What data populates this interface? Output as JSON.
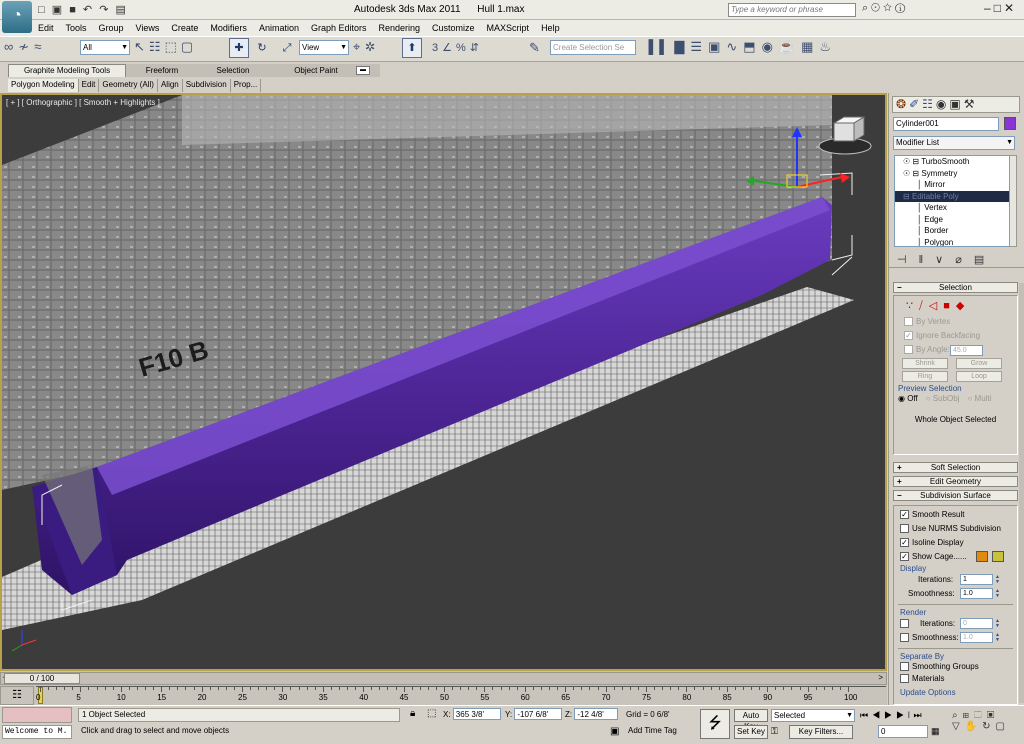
{
  "app": {
    "title": "Autodesk 3ds Max  2011",
    "file": "Hull 1.max",
    "search_placeholder": "Type a keyword or phrase"
  },
  "menu": [
    "Edit",
    "Tools",
    "Group",
    "Views",
    "Create",
    "Modifiers",
    "Animation",
    "Graph Editors",
    "Rendering",
    "Customize",
    "MAXScript",
    "Help"
  ],
  "toolbar": {
    "filter_value": "All",
    "ref_coord_value": "View",
    "named_selection_placeholder": "Create Selection Se",
    "snap_value": "3"
  },
  "ribbon": {
    "tabs": [
      "Graphite Modeling Tools",
      "Freeform",
      "Selection",
      "Object Paint"
    ],
    "subtabs": [
      "Polygon Modeling",
      "Edit",
      "Geometry (All)",
      "Align",
      "Subdivision",
      "Prop..."
    ]
  },
  "viewport": {
    "label": "[ + ] [ Orthographic ] [ Smooth + Highlights ]",
    "hull_text": "F10 B",
    "colors": {
      "hull": "#5b2fa3",
      "bg": "#3c3c3c"
    }
  },
  "panel": {
    "object_name": "Cylinder001",
    "object_color": "#8a33d6",
    "modifier_list_label": "Modifier List",
    "stack": [
      {
        "label": "TurboSmooth",
        "level": 0
      },
      {
        "label": "Symmetry",
        "level": 0
      },
      {
        "label": "Mirror",
        "level": 1
      },
      {
        "label": "Editable Poly",
        "level": 0,
        "selected": true
      },
      {
        "label": "Vertex",
        "level": 1
      },
      {
        "label": "Edge",
        "level": 1
      },
      {
        "label": "Border",
        "level": 1
      },
      {
        "label": "Polygon",
        "level": 1
      }
    ],
    "selection": {
      "title": "Selection",
      "by_vertex": "By Vertex",
      "ignore_backfacing": "Ignore Backfacing",
      "by_angle": "By Angle:",
      "angle_value": "45.0",
      "shrink": "Shrink",
      "grow": "Grow",
      "ring": "Ring",
      "loop": "Loop",
      "preview_title": "Preview Selection",
      "preview_options": [
        "Off",
        "SubObj",
        "Multi"
      ],
      "status": "Whole Object Selected"
    },
    "soft_selection": "Soft Selection",
    "edit_geometry": "Edit Geometry",
    "subdivision_surface": {
      "title": "Subdivision Surface",
      "smooth_result": "Smooth Result",
      "use_nurms": "Use NURMS Subdivision",
      "isoline": "Isoline Display",
      "show_cage": "Show Cage......",
      "cage_colors": [
        "#e08a10",
        "#c8c23a"
      ],
      "display_title": "Display",
      "iterations_label": "Iterations:",
      "iterations_value": "1",
      "smoothness_label": "Smoothness:",
      "smoothness_value": "1.0",
      "render_title": "Render",
      "render_iterations_value": "0",
      "render_smoothness_value": "1.0",
      "separate_title": "Separate By",
      "smoothing_groups": "Smoothing Groups",
      "materials": "Materials",
      "update_options": "Update Options"
    }
  },
  "timeline": {
    "frame_counter": "0 / 100",
    "ticks": [
      "0",
      "5",
      "10",
      "15",
      "20",
      "25",
      "30",
      "35",
      "40",
      "45",
      "50",
      "55",
      "60",
      "65",
      "70",
      "75",
      "80",
      "85",
      "90",
      "95",
      "100"
    ]
  },
  "status": {
    "welcome": "Welcome to M.",
    "selected": "1 Object Selected",
    "prompt": "Click and drag to select and move objects",
    "x_label": "X:",
    "x_value": "365 3/8'",
    "y_label": "Y:",
    "y_value": "-107 6/8'",
    "z_label": "Z:",
    "z_value": "-12 4/8'",
    "grid": "Grid = 0 6/8'",
    "add_time_tag": "Add Time Tag",
    "auto_key": "Auto Key",
    "set_key": "Set Key",
    "key_filters": "Key Filters...",
    "selected_value": "Selected",
    "frame_value": "0"
  }
}
